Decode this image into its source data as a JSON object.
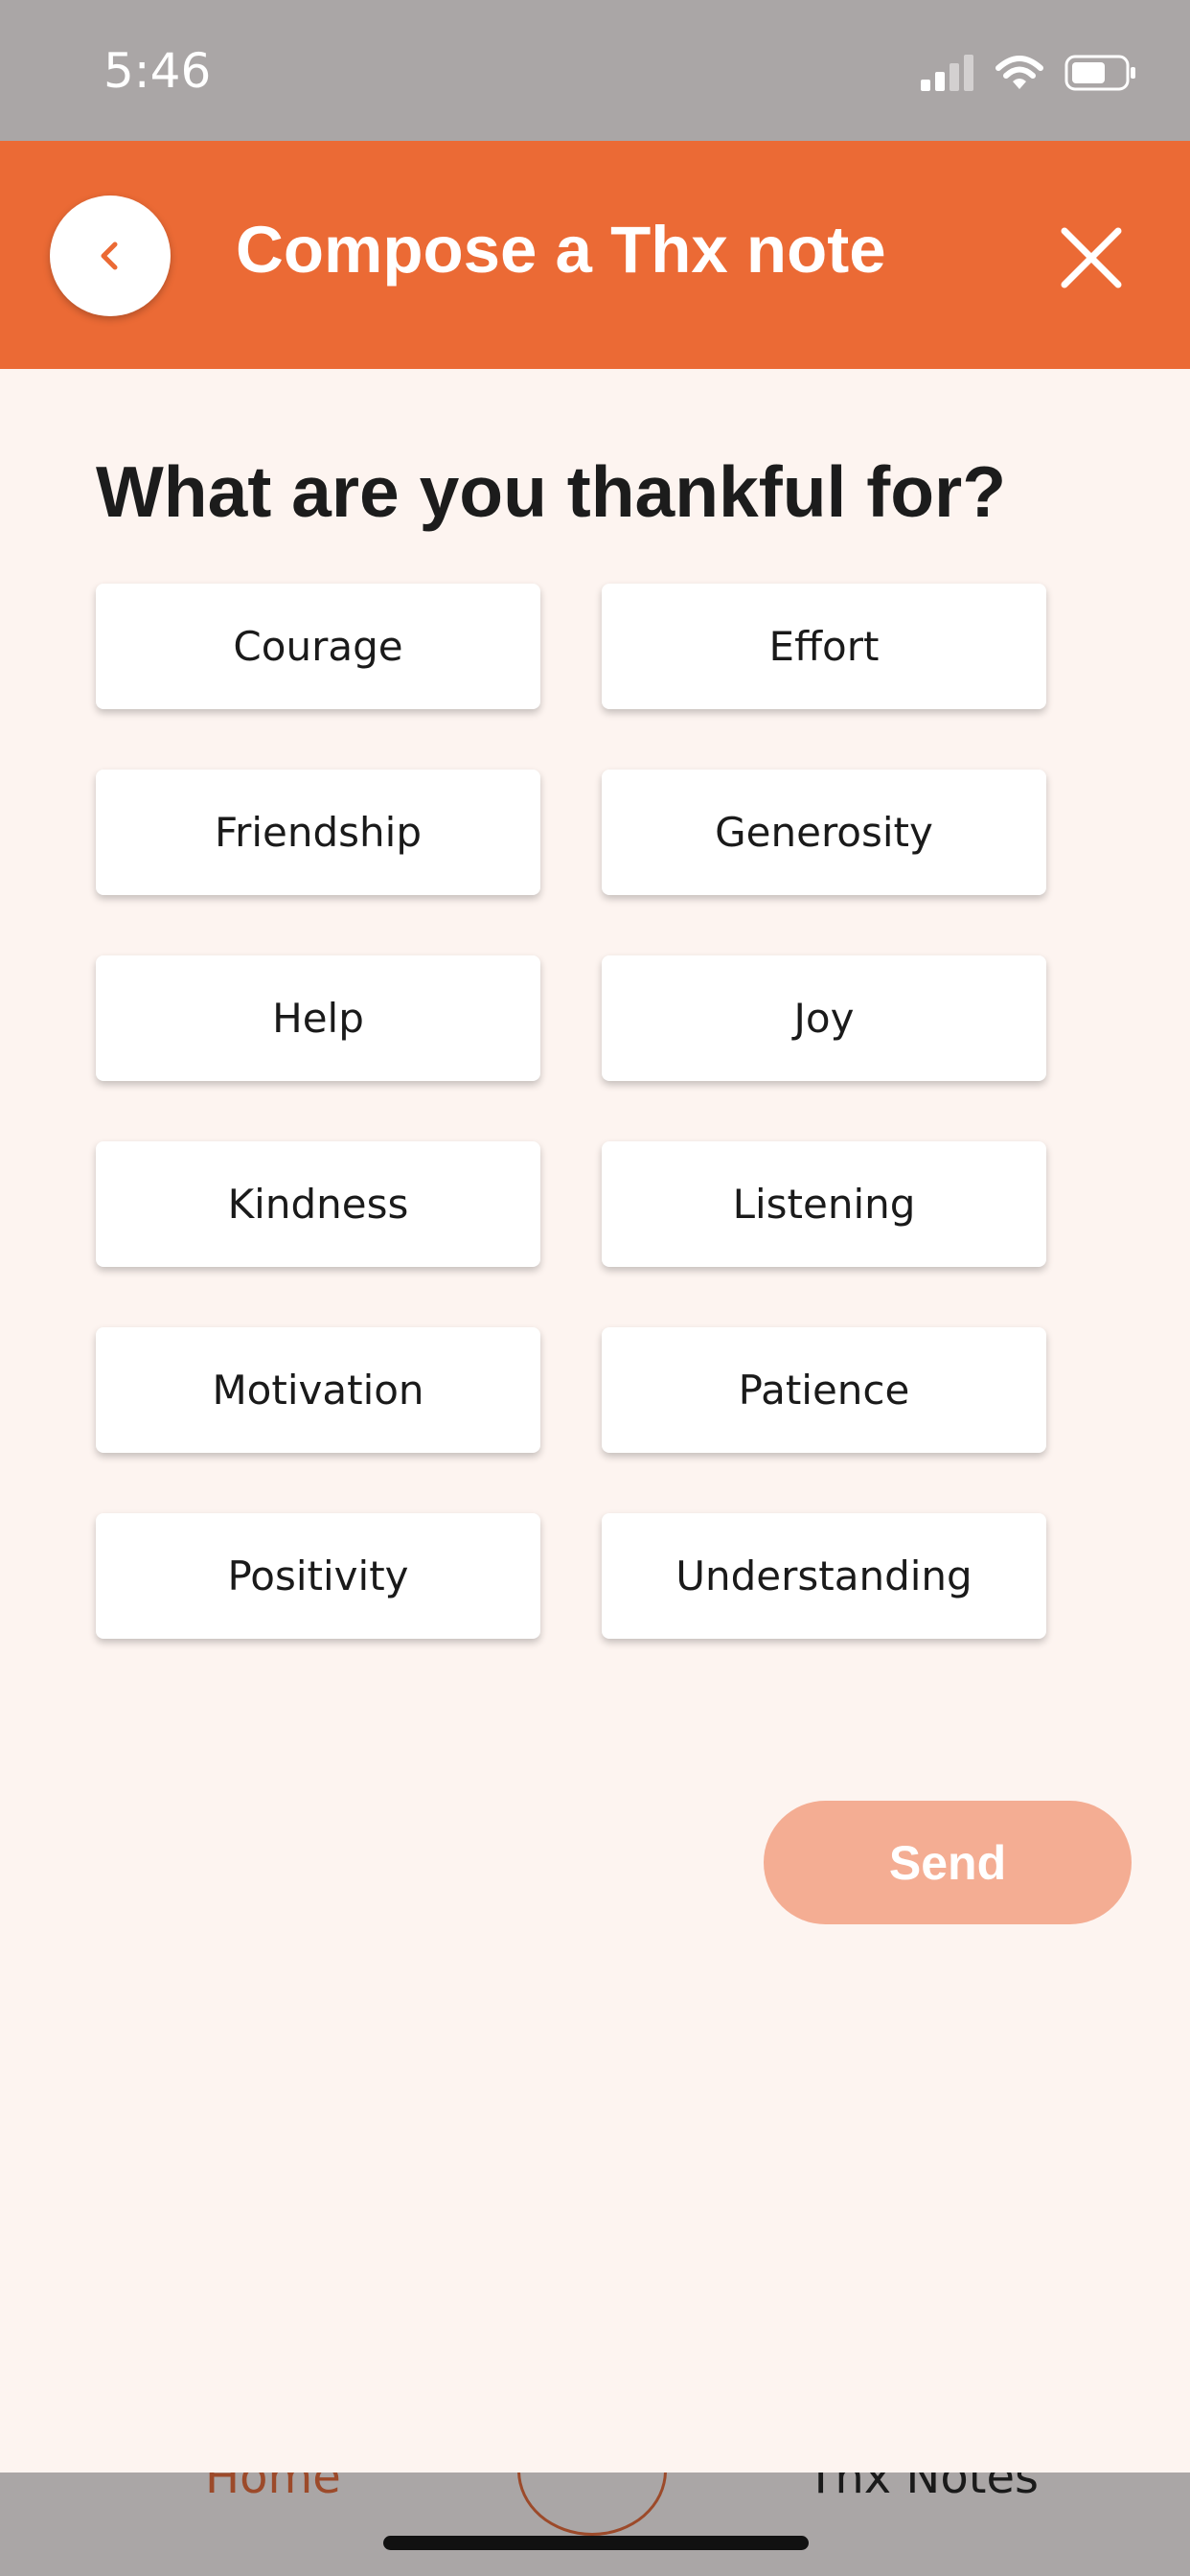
{
  "status_bar": {
    "time": "5:46",
    "icons": [
      "signal-icon",
      "wifi-icon",
      "battery-icon"
    ]
  },
  "header": {
    "title": "Compose a Thx note",
    "back_icon": "chevron-left-icon",
    "close_icon": "close-icon",
    "background_color": "#eb6a35"
  },
  "main": {
    "question": "What are you thankful for?",
    "options": [
      "Courage",
      "Effort",
      "Friendship",
      "Generosity",
      "Help",
      "Joy",
      "Kindness",
      "Listening",
      "Motivation",
      "Patience",
      "Positivity",
      "Understanding"
    ],
    "send_label": "Send",
    "send_color": "#f4ad93"
  },
  "tab_bar": {
    "home_label": "Home",
    "notes_label": "Thx Notes"
  }
}
